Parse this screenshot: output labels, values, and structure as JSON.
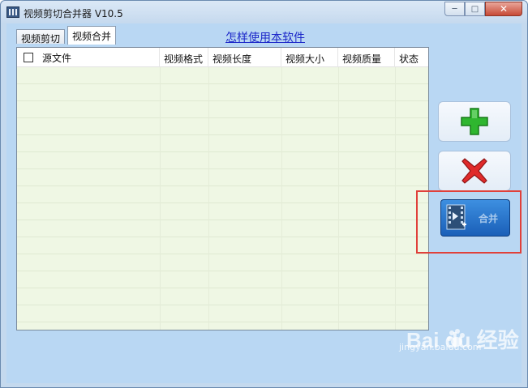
{
  "window": {
    "title": "视频剪切合并器 V10.5",
    "controls": {
      "minimize": "─",
      "maximize": "□",
      "close": "✕"
    }
  },
  "tabs": [
    {
      "label": "视频剪切",
      "active": false
    },
    {
      "label": "视频合并",
      "active": true
    }
  ],
  "help_link": "怎样使用本软件",
  "table": {
    "columns": [
      "源文件",
      "视频格式",
      "视频长度",
      "视频大小",
      "视频质量",
      "状态"
    ],
    "rows": []
  },
  "buttons": {
    "add_icon": "green-plus-icon",
    "delete_icon": "red-x-icon",
    "merge_label": "合并"
  },
  "watermark": {
    "text": "Bai du 经验",
    "sub": "jingyan.baidu.com"
  },
  "colors": {
    "client_bg": "#b9d7f3",
    "table_bg": "#eff7e4",
    "link": "#1d28c9",
    "merge_btn": "#1a5fb8",
    "highlight": "#e0403a"
  }
}
